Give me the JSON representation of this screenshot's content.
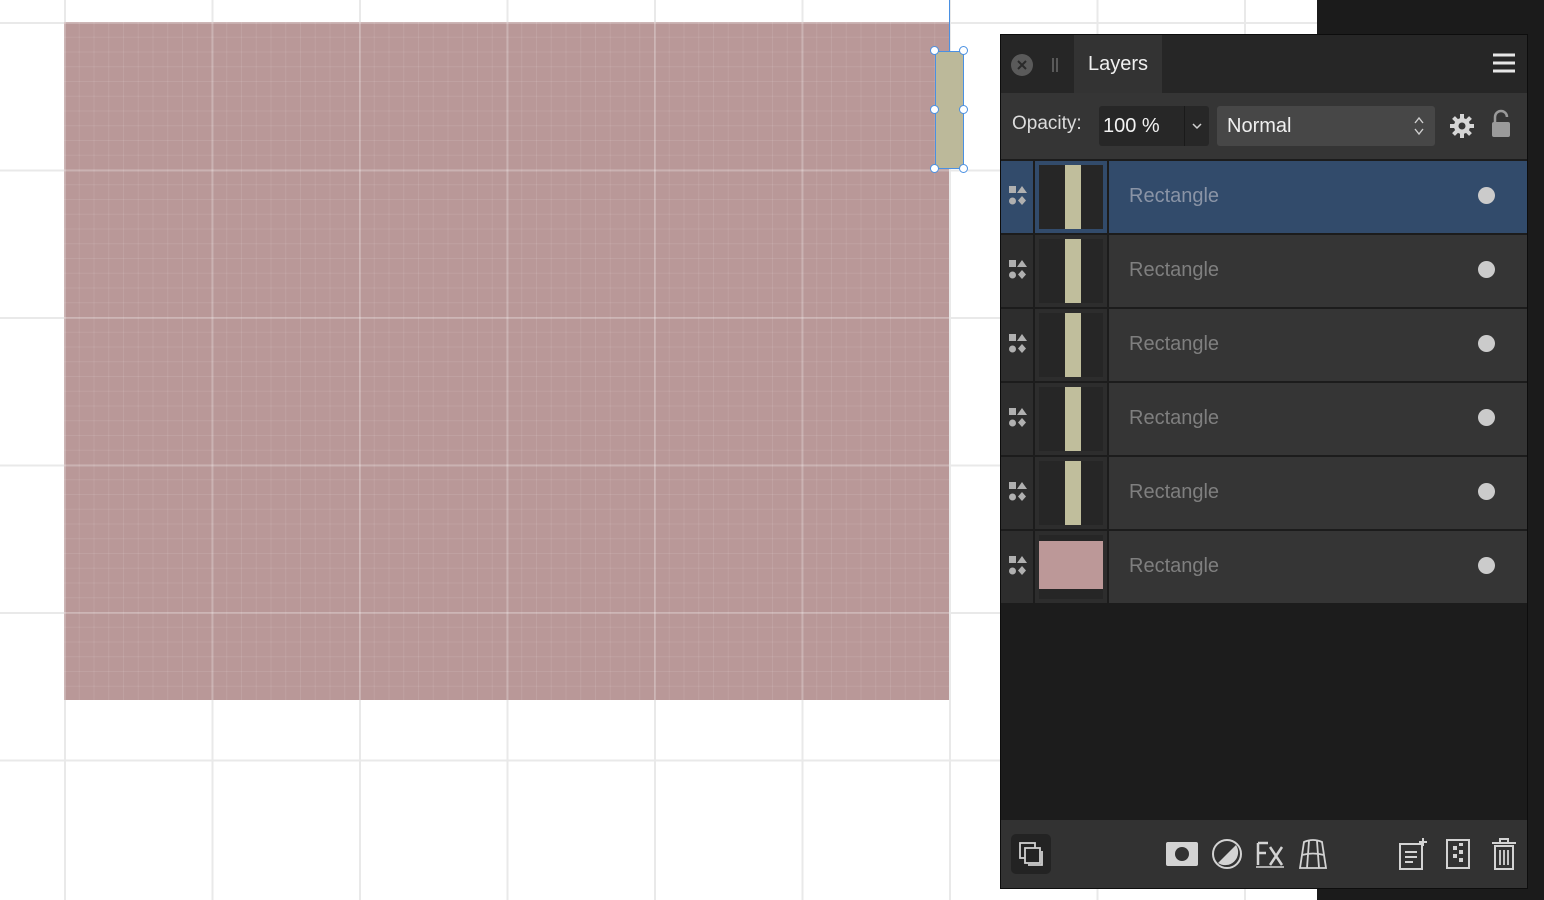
{
  "panel": {
    "title": "Layers",
    "opacity_label": "Opacity:",
    "opacity_value": "100 %",
    "blend_mode": "Normal"
  },
  "layers": [
    {
      "name": "Rectangle",
      "selected": true,
      "thumbnail": "tan-vertical-bar"
    },
    {
      "name": "Rectangle",
      "selected": false,
      "thumbnail": "tan-vertical-bar"
    },
    {
      "name": "Rectangle",
      "selected": false,
      "thumbnail": "tan-vertical-bar"
    },
    {
      "name": "Rectangle",
      "selected": false,
      "thumbnail": "tan-vertical-bar"
    },
    {
      "name": "Rectangle",
      "selected": false,
      "thumbnail": "tan-vertical-bar"
    },
    {
      "name": "Rectangle",
      "selected": false,
      "thumbnail": "pink-rectangle"
    }
  ],
  "colors": {
    "large_rectangle": "#b99898",
    "small_rectangle": "#bcb99a",
    "selection": "#4a90e2",
    "selected_row": "#324b6b"
  },
  "icons": {
    "header": [
      "close-icon",
      "grip-icon",
      "menu-icon"
    ],
    "toolbar": [
      "chevron-down-icon",
      "up-down-arrows-icon",
      "gear-icon",
      "lock-icon"
    ],
    "bottom": [
      "layers-stack-icon",
      "mask-icon",
      "adjustment-icon",
      "fx-icon",
      "mesh-warp-icon",
      "add-layer-icon",
      "add-pixel-layer-icon",
      "trash-icon"
    ]
  }
}
